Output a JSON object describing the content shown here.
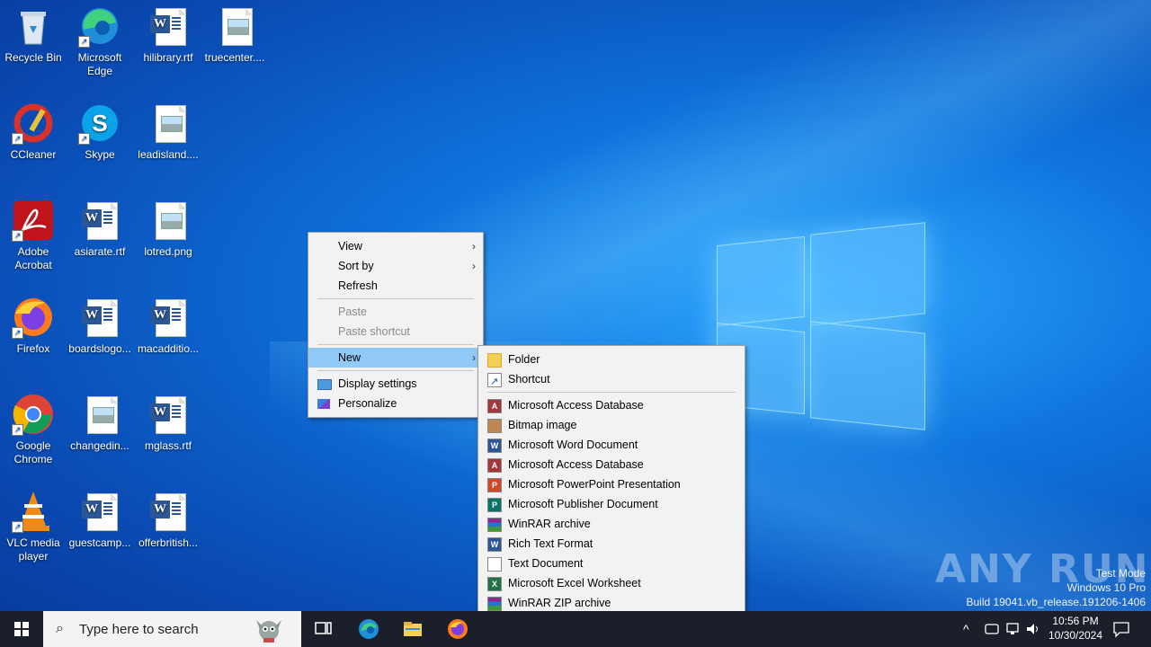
{
  "desktop_icons": [
    {
      "label": "Recycle Bin",
      "icon": "recycle-bin-icon"
    },
    {
      "label": "Microsoft Edge",
      "icon": "edge-icon"
    },
    {
      "label": "hilibrary.rtf",
      "icon": "word-doc-icon"
    },
    {
      "label": "truecenter....",
      "icon": "image-file-icon"
    },
    {
      "label": "CCleaner",
      "icon": "ccleaner-icon"
    },
    {
      "label": "Skype",
      "icon": "skype-icon"
    },
    {
      "label": "leadisland....",
      "icon": "image-file-icon"
    },
    {
      "label": "Adobe Acrobat",
      "icon": "acrobat-icon"
    },
    {
      "label": "asiarate.rtf",
      "icon": "word-doc-icon"
    },
    {
      "label": "lotred.png",
      "icon": "image-file-icon"
    },
    {
      "label": "Firefox",
      "icon": "firefox-icon"
    },
    {
      "label": "boardslogo...",
      "icon": "word-doc-icon"
    },
    {
      "label": "macadditio...",
      "icon": "word-doc-icon"
    },
    {
      "label": "Google Chrome",
      "icon": "chrome-icon"
    },
    {
      "label": "changedin...",
      "icon": "image-file-icon"
    },
    {
      "label": "mglass.rtf",
      "icon": "word-doc-icon"
    },
    {
      "label": "VLC media player",
      "icon": "vlc-icon"
    },
    {
      "label": "guestcamp...",
      "icon": "word-doc-icon"
    },
    {
      "label": "offerbritish...",
      "icon": "word-doc-icon"
    }
  ],
  "context_menu": {
    "view": "View",
    "sort_by": "Sort by",
    "refresh": "Refresh",
    "paste": "Paste",
    "paste_shortcut": "Paste shortcut",
    "new": "New",
    "display_settings": "Display settings",
    "personalize": "Personalize",
    "arrow": "›"
  },
  "new_submenu": {
    "folder": "Folder",
    "shortcut": "Shortcut",
    "items": [
      {
        "label": "Microsoft Access Database",
        "icon": "access-icon",
        "color": "#a4373a",
        "letter": "A"
      },
      {
        "label": "Bitmap image",
        "icon": "bitmap-icon",
        "color": "#c08850",
        "letter": ""
      },
      {
        "label": "Microsoft Word Document",
        "icon": "word-icon",
        "color": "#2b5797",
        "letter": "W"
      },
      {
        "label": "Microsoft Access Database",
        "icon": "access-icon",
        "color": "#a4373a",
        "letter": "A"
      },
      {
        "label": "Microsoft PowerPoint Presentation",
        "icon": "powerpoint-icon",
        "color": "#d24726",
        "letter": "P"
      },
      {
        "label": "Microsoft Publisher Document",
        "icon": "publisher-icon",
        "color": "#077568",
        "letter": "P"
      },
      {
        "label": "WinRAR archive",
        "icon": "winrar-icon",
        "color": "#8b2a8f",
        "letter": ""
      },
      {
        "label": "Rich Text Format",
        "icon": "rtf-icon",
        "color": "#2b5797",
        "letter": "W"
      },
      {
        "label": "Text Document",
        "icon": "text-doc-icon",
        "color": "#ffffff",
        "letter": ""
      },
      {
        "label": "Microsoft Excel Worksheet",
        "icon": "excel-icon",
        "color": "#217346",
        "letter": "X"
      },
      {
        "label": "WinRAR ZIP archive",
        "icon": "winrar-zip-icon",
        "color": "#8b2a8f",
        "letter": ""
      }
    ]
  },
  "taskbar": {
    "search_placeholder": "Type here to search",
    "time": "10:56 PM",
    "date": "10/30/2024"
  },
  "watermark": {
    "brand": "ANY RUN",
    "line1": "Test Mode",
    "line2": "Windows 10 Pro",
    "line3": "Build 19041.vb_release.191206-1406"
  },
  "colors": {
    "menu_bg": "#f2f2f2",
    "menu_highlight": "#91c9f7",
    "taskbar": "#1b1f2a"
  }
}
